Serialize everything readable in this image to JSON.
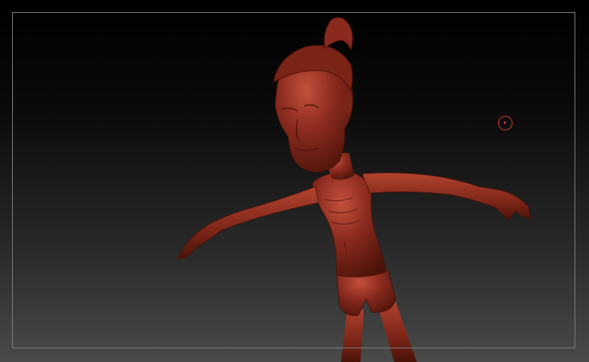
{
  "scene": {
    "material_color": "#8a2a1e",
    "highlight_color": "#c4503c",
    "shadow_color": "#4a1208",
    "background_top": "#000000",
    "background_bottom": "#4a4a4a",
    "frame_color": "#7a7a7a",
    "brush_color": "#c43a2a",
    "model_icon": "sculpted-character-model",
    "cursor_icon": "brush-circle-icon"
  }
}
